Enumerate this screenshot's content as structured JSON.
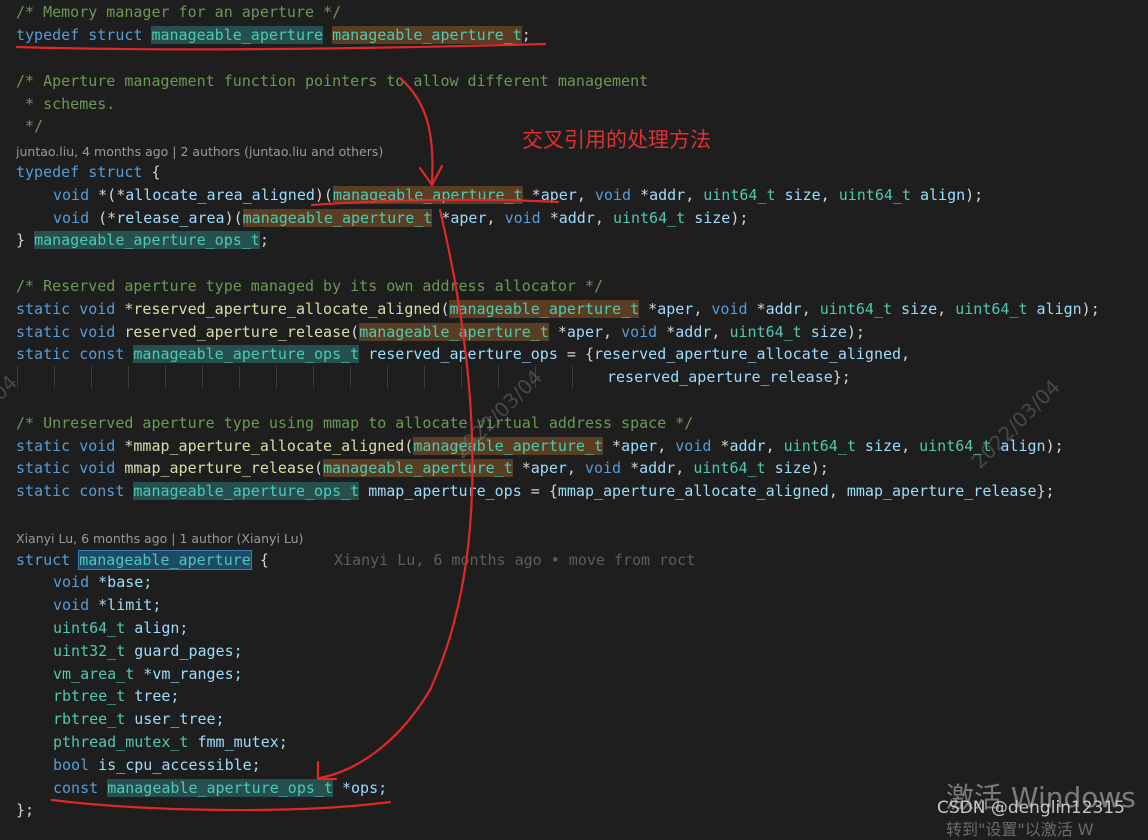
{
  "colors": {
    "background": "#1e1e1e",
    "comment": "#6a9955",
    "keyword": "#569cd6",
    "type": "#4ec9b0",
    "function": "#dcdcaa",
    "variable": "#9cdcfe",
    "annotation": "#e03030"
  },
  "code": {
    "l1": "/* Memory manager for an aperture */",
    "l2_kw": "typedef struct",
    "l2_type": "manageable_aperture",
    "l2_type2": "manageable_aperture_t",
    "l2_end": ";",
    "l3": "/* Aperture management function pointers to allow different management",
    "l4": " * schemes.",
    "l5": " */",
    "lens1": "juntao.liu, 4 months ago | 2 authors (juntao.liu and others)",
    "l6_kw": "typedef struct",
    "l6_end": " {",
    "l7_void": "void",
    "l7_a": " *(*",
    "l7_fn": "allocate_area_aligned",
    "l7_b": ")(",
    "l7_type": "manageable_aperture_t",
    "l7_c": " *",
    "l7_aper": "aper",
    "l7_comma1": ", ",
    "l7_void2": "void",
    "l7_d": " *",
    "l7_addr": "addr",
    "l7_comma2": ", ",
    "l7_u64": "uint64_t",
    "l7_size": " size",
    "l7_comma3": ", ",
    "l7_u64b": "uint64_t",
    "l7_align": " align",
    "l7_end": ");",
    "l8_void": "void",
    "l8_a": " (*",
    "l8_fn": "release_area",
    "l8_b": ")(",
    "l8_type": "manageable_aperture_t",
    "l8_c": " *",
    "l8_aper": "aper",
    "l8_comma1": ", ",
    "l8_void2": "void",
    "l8_d": " *",
    "l8_addr": "addr",
    "l8_comma2": ", ",
    "l8_u64": "uint64_t",
    "l8_size": " size",
    "l8_end": ");",
    "l9_a": "} ",
    "l9_type": "manageable_aperture_ops_t",
    "l9_end": ";",
    "l10": "/* Reserved aperture type managed by its own address allocator */",
    "l11_kw": "static void",
    "l11_a": " *",
    "l11_fn": "reserved_aperture_allocate_aligned",
    "l11_b": "(",
    "l11_type": "manageable_aperture_t",
    "l11_c": " *",
    "l11_aper": "aper",
    "l11_comma1": ", ",
    "l11_void": "void",
    "l11_d": " *",
    "l11_addr": "addr",
    "l11_comma2": ", ",
    "l11_u64": "uint64_t",
    "l11_size": " size",
    "l11_comma3": ", ",
    "l11_u64b": "uint64_t",
    "l11_align": " align",
    "l11_end": ");",
    "l12_kw": "static void",
    "l12_a": " ",
    "l12_fn": "reserved_aperture_release",
    "l12_b": "(",
    "l12_type": "manageable_aperture_t",
    "l12_c": " *",
    "l12_aper": "aper",
    "l12_comma1": ", ",
    "l12_void": "void",
    "l12_d": " *",
    "l12_addr": "addr",
    "l12_comma2": ", ",
    "l12_u64": "uint64_t",
    "l12_size": " size",
    "l12_end": ");",
    "l13_kw": "static const",
    "l13_a": " ",
    "l13_type": "manageable_aperture_ops_t",
    "l13_b": " ",
    "l13_var": "reserved_aperture_ops",
    "l13_c": " = {",
    "l13_fn": "reserved_aperture_allocate_aligned",
    "l13_end": ",",
    "l14_fn": "reserved_aperture_release",
    "l14_end": "};",
    "l15": "/* Unreserved aperture type using mmap to allocate virtual address space */",
    "l16_kw": "static void",
    "l16_a": " *",
    "l16_fn": "mmap_aperture_allocate_aligned",
    "l16_b": "(",
    "l16_type": "manageable_aperture_t",
    "l16_c": " *",
    "l16_aper": "aper",
    "l16_comma1": ", ",
    "l16_void": "void",
    "l16_d": " *",
    "l16_addr": "addr",
    "l16_comma2": ", ",
    "l16_u64": "uint64_t",
    "l16_size": " size",
    "l16_comma3": ", ",
    "l16_u64b": "uint64_t",
    "l16_align": " align",
    "l16_end": ");",
    "l17_kw": "static void",
    "l17_a": " ",
    "l17_fn": "mmap_aperture_release",
    "l17_b": "(",
    "l17_type": "manageable_aperture_t",
    "l17_c": " *",
    "l17_aper": "aper",
    "l17_comma1": ", ",
    "l17_void": "void",
    "l17_d": " *",
    "l17_addr": "addr",
    "l17_comma2": ", ",
    "l17_u64": "uint64_t",
    "l17_size": " size",
    "l17_end": ");",
    "l18_kw": "static const",
    "l18_a": " ",
    "l18_type": "manageable_aperture_ops_t",
    "l18_b": " ",
    "l18_var": "mmap_aperture_ops",
    "l18_c": " = {",
    "l18_fn1": "mmap_aperture_allocate_aligned",
    "l18_d": ", ",
    "l18_fn2": "mmap_aperture_release",
    "l18_end": "};",
    "lens2": "Xianyi Lu, 6 months ago | 1 author (Xianyi Lu)",
    "l19_kw": "struct",
    "l19_a": " ",
    "l19_type": "manageable_aperture",
    "l19_end": " {",
    "l19_ghost": "Xianyi Lu, 6 months ago • move from roct",
    "l20_t": "void",
    "l20_v": " *base;",
    "l21_t": "void",
    "l21_v": " *limit;",
    "l22_t": "uint64_t",
    "l22_v": " align;",
    "l23_t": "uint32_t",
    "l23_v": " guard_pages;",
    "l24_t": "vm_area_t",
    "l24_v": " *vm_ranges;",
    "l25_t": "rbtree_t",
    "l25_v": " tree;",
    "l26_t": "rbtree_t",
    "l26_v": " user_tree;",
    "l27_t": "pthread_mutex_t",
    "l27_v": " fmm_mutex;",
    "l28_t": "bool",
    "l28_v": " is_cpu_accessible;",
    "l29_kw": "const",
    "l29_a": " ",
    "l29_type": "manageable_aperture_ops_t",
    "l29_v": " *ops;",
    "l30": "};"
  },
  "annotation": {
    "text": "交叉引用的处理方法"
  },
  "watermarks": {
    "w1": "/04",
    "w2": "2022/03/04",
    "w3": "2022/03/04"
  },
  "credit": "CSDN @denglin12315",
  "os_notice": {
    "title": "激活 Windows",
    "subtitle": "转到\"设置\"以激活 W"
  }
}
